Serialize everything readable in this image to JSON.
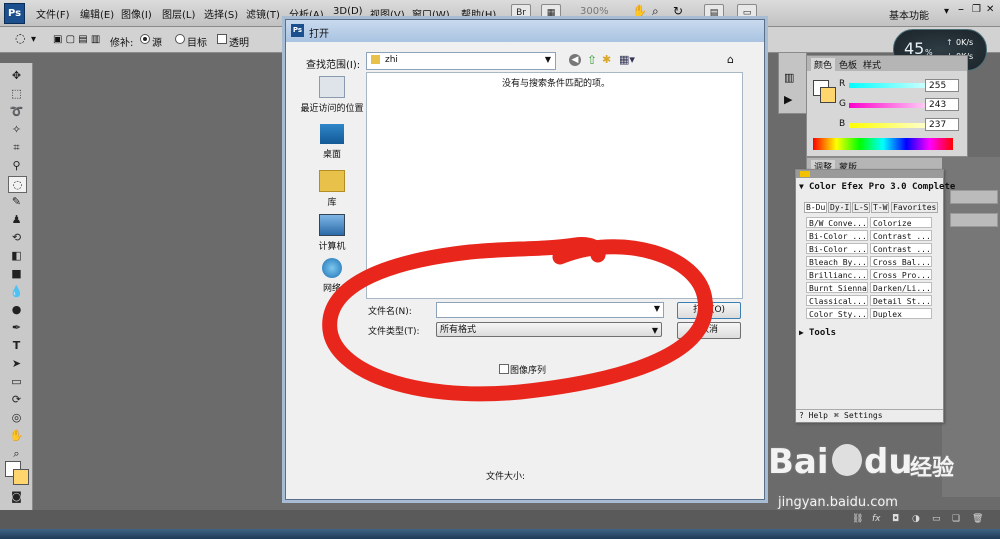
{
  "app": {
    "logo": "Ps"
  },
  "menu": [
    "文件(F)",
    "编辑(E)",
    "图像(I)",
    "图层(L)",
    "选择(S)",
    "滤镜(T)",
    "分析(A)",
    "3D(D)",
    "视图(V)",
    "窗口(W)",
    "帮助(H)"
  ],
  "toolbar": {
    "br": "Br",
    "zoom": "300%",
    "workspace": "基本功能"
  },
  "options": {
    "repair": "修补:",
    "source": "源",
    "target": "目标",
    "transparent": "透明"
  },
  "speed": {
    "percent": "45",
    "unit": "%",
    "up": "0K/s",
    "down": "0K/s"
  },
  "dialog": {
    "title": "打开",
    "look_in_label": "查找范围(I):",
    "look_in_value": "zhi",
    "empty_message": "没有与搜索条件匹配的项。",
    "places": [
      "最近访问的位置",
      "桌面",
      "库",
      "计算机",
      "网络"
    ],
    "filename_label": "文件名(N):",
    "filetype_label": "文件类型(T):",
    "filetype_value": "所有格式",
    "open_button": "打开(O)",
    "cancel_button": "取消",
    "image_sequence": "图像序列",
    "file_size_label": "文件大小:"
  },
  "color_panel": {
    "tabs": [
      "颜色",
      "色板",
      "样式"
    ],
    "r_label": "R",
    "r_value": "255",
    "g_label": "G",
    "g_value": "243",
    "b_label": "B",
    "b_value": "237",
    "swatch": "#fff3ed"
  },
  "adjust_panel": {
    "tabs": [
      "调整",
      "蒙版"
    ]
  },
  "color_efex": {
    "title": "Color Efex Pro 3.0 Complete",
    "tabs": [
      "B-Du",
      "Dy-I",
      "L-S",
      "T-W",
      "Favorites"
    ],
    "filters": [
      "B/W Conve...",
      "Colorize",
      "Bi-Color ...",
      "Contrast ...",
      "Bi-Color ...",
      "Contrast ...",
      "Bleach By...",
      "Cross Bal...",
      "Brillianc...",
      "Cross Pro...",
      "Burnt Sienna",
      "Darken/Li...",
      "Classical...",
      "Detail St...",
      "Color Sty...",
      "Duplex"
    ],
    "tools": "Tools",
    "help": "? Help",
    "settings": "Settings"
  },
  "watermark": {
    "brand": "Bai",
    "brand2": "du",
    "tagline": "经验",
    "url": "jingyan.baidu.com"
  },
  "colors": {
    "annotation": "#e8261c",
    "dialog_border": "#5a6f8a"
  }
}
